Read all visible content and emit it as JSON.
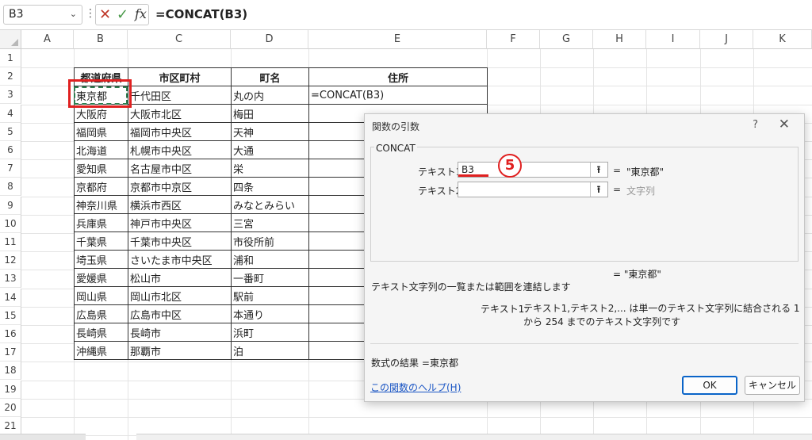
{
  "formula_bar": {
    "name_box": "B3",
    "formula": "=CONCAT(B3)",
    "icons": [
      "cancel-icon",
      "enter-icon",
      "fx-icon"
    ]
  },
  "sheet": {
    "columns": [
      "A",
      "B",
      "C",
      "D",
      "E",
      "F",
      "G",
      "H",
      "I",
      "J",
      "K"
    ],
    "rows": [
      "1",
      "2",
      "3",
      "4",
      "5",
      "6",
      "7",
      "8",
      "9",
      "10",
      "11",
      "12",
      "13",
      "14",
      "15",
      "16",
      "17",
      "18",
      "19",
      "20",
      "21"
    ],
    "table": {
      "headers": [
        "都道府県",
        "市区町村",
        "町名",
        "住所"
      ],
      "data": [
        [
          "東京都",
          "千代田区",
          "丸の内",
          "=CONCAT(B3)"
        ],
        [
          "大阪府",
          "大阪市北区",
          "梅田",
          ""
        ],
        [
          "福岡県",
          "福岡市中央区",
          "天神",
          ""
        ],
        [
          "北海道",
          "札幌市中央区",
          "大通",
          ""
        ],
        [
          "愛知県",
          "名古屋市中区",
          "栄",
          ""
        ],
        [
          "京都府",
          "京都市中京区",
          "四条",
          ""
        ],
        [
          "神奈川県",
          "横浜市西区",
          "みなとみらい",
          ""
        ],
        [
          "兵庫県",
          "神戸市中央区",
          "三宮",
          ""
        ],
        [
          "千葉県",
          "千葉市中央区",
          "市役所前",
          ""
        ],
        [
          "埼玉県",
          "さいたま市中央区",
          "浦和",
          ""
        ],
        [
          "愛媛県",
          "松山市",
          "一番町",
          ""
        ],
        [
          "岡山県",
          "岡山市北区",
          "駅前",
          ""
        ],
        [
          "広島県",
          "広島市中区",
          "本通り",
          ""
        ],
        [
          "長崎県",
          "長崎市",
          "浜町",
          ""
        ],
        [
          "沖縄県",
          "那覇市",
          "泊",
          ""
        ]
      ]
    }
  },
  "dialog": {
    "title": "関数の引数",
    "help": "?",
    "close": "✕",
    "function_name": "CONCAT",
    "args": [
      {
        "label": "テキスト1",
        "value": "B3",
        "eq": "=",
        "result": "\"東京都\""
      },
      {
        "label": "テキスト2",
        "value": "",
        "eq": "=",
        "result": "文字列"
      }
    ],
    "overall_result": "=  \"東京都\"",
    "step_marker": "5",
    "description": "テキスト文字列の一覧または範囲を連結します",
    "arg_help_name": "テキスト1:",
    "arg_help_text": "テキスト1,テキスト2,... は単一のテキスト文字列に結合される 1 から 254 までのテキスト文字列です",
    "formula_result_label": "数式の結果 =",
    "formula_result_value": "東京都",
    "help_link": "この関数のヘルプ(H)",
    "ok": "OK",
    "cancel": "キャンセル"
  },
  "colors": {
    "highlight": "#e02020",
    "marquee": "#2e7d4f",
    "link": "#1a55c4"
  }
}
